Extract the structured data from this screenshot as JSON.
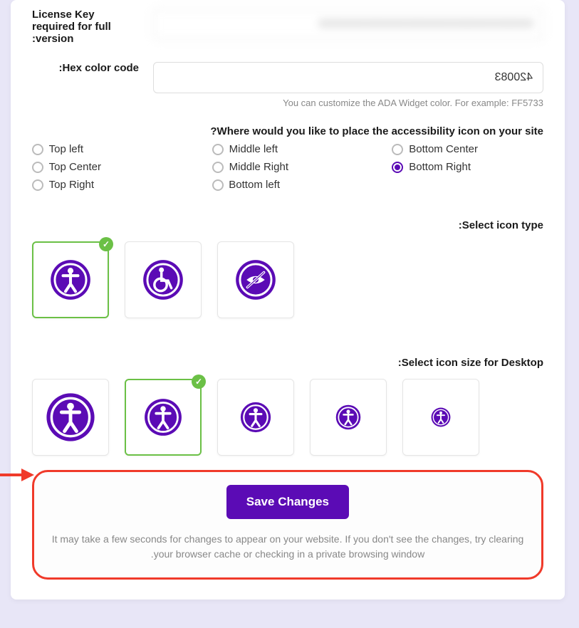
{
  "license": {
    "label": "License Key required for full version:",
    "value": "XXXXXXXXXXXXXXXXXXXXXXXXXX"
  },
  "hex": {
    "label": "Hex color code:",
    "value": "420083",
    "helper": "You can customize the ADA Widget color. For example: FF5733"
  },
  "placement": {
    "label": "Where would you like to place the accessibility icon on your site?",
    "options": [
      {
        "label": "Top left"
      },
      {
        "label": "Middle left"
      },
      {
        "label": "Bottom Center"
      },
      {
        "label": "Top Center"
      },
      {
        "label": "Middle Right"
      },
      {
        "label": "Bottom Right",
        "selected": true
      },
      {
        "label": "Top Right"
      },
      {
        "label": "Bottom left"
      }
    ]
  },
  "iconType": {
    "label": "Select icon type:",
    "items": [
      {
        "name": "accessibility-person",
        "selected": true
      },
      {
        "name": "wheelchair"
      },
      {
        "name": "low-vision"
      }
    ]
  },
  "iconSize": {
    "label": "Select icon size for Desktop:",
    "items": [
      {
        "size": 70
      },
      {
        "size": 54,
        "selected": true
      },
      {
        "size": 44
      },
      {
        "size": 36
      },
      {
        "size": 28
      }
    ]
  },
  "save": {
    "button": "Save Changes",
    "note": "It may take a few seconds for changes to appear on your website. If you don't see the changes, try clearing your browser cache or checking in a private browsing window."
  },
  "colors": {
    "brand": "#5b0bb5",
    "accent": "#6bc046",
    "highlight": "#f03a2a"
  },
  "icons": {
    "check": "✓"
  }
}
